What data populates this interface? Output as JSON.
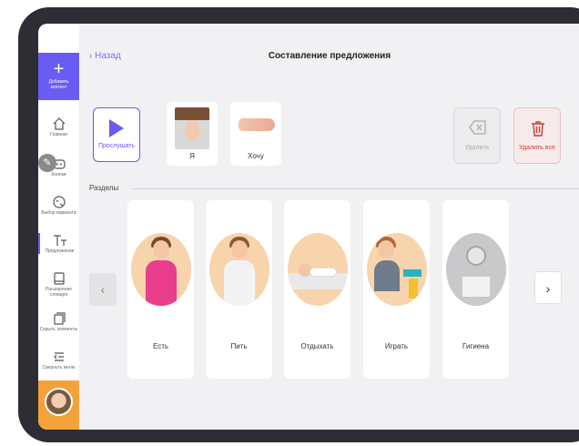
{
  "sidebar": {
    "add_label": "Добавить контент",
    "items": [
      {
        "label": "Главная",
        "icon": "home-icon"
      },
      {
        "label": "Кнопки",
        "icon": "buttons-icon"
      },
      {
        "label": "Выбор варианта",
        "icon": "choice-icon"
      },
      {
        "label": "Предложения",
        "icon": "text-icon"
      },
      {
        "label": "Расширение словаря",
        "icon": "dictionary-icon"
      },
      {
        "label": "Скрыть элементы",
        "icon": "hide-icon"
      },
      {
        "label": "Свернуть меню",
        "icon": "collapse-icon"
      }
    ]
  },
  "header": {
    "back_label": "Назад",
    "title": "Составление предложения"
  },
  "sentence": {
    "play_label": "Прослушать",
    "words": [
      {
        "label": "Я"
      },
      {
        "label": "Хочу"
      }
    ],
    "delete_label": "Удалить",
    "delete_all_label": "Удалить все"
  },
  "sections": {
    "label": "Разделы",
    "categories": [
      {
        "label": "Есть"
      },
      {
        "label": "Пить"
      },
      {
        "label": "Отдыхать"
      },
      {
        "label": "Играть"
      },
      {
        "label": "Гигиена"
      }
    ]
  },
  "colors": {
    "accent": "#6a5cf2",
    "danger": "#d23a3a",
    "avatar_bg": "#f3a23a",
    "card_circle": "#f8d4ad"
  }
}
